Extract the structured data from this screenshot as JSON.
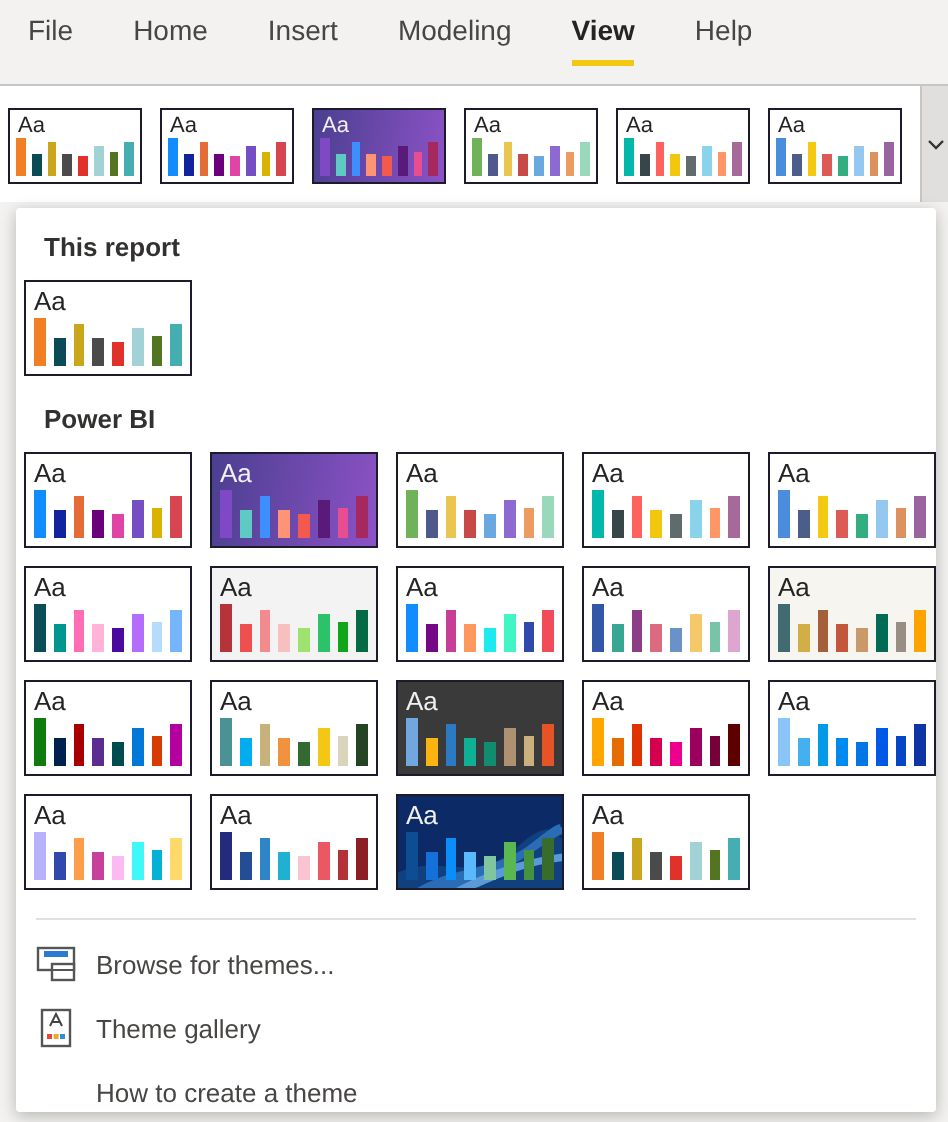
{
  "tabs": [
    {
      "label": "File",
      "selected": false
    },
    {
      "label": "Home",
      "selected": false
    },
    {
      "label": "Insert",
      "selected": false
    },
    {
      "label": "Modeling",
      "selected": false
    },
    {
      "label": "View",
      "selected": true
    },
    {
      "label": "Help",
      "selected": false
    }
  ],
  "ribbon": {
    "themes": [
      {
        "label": "Aa",
        "kind": "light",
        "bars": [
          {
            "color": "#f07f26"
          },
          {
            "color": "#0b4a57"
          },
          {
            "color": "#c9a61a"
          },
          {
            "color": "#4b4b4b"
          },
          {
            "color": "#e0312a"
          },
          {
            "color": "#a2d2d6"
          },
          {
            "color": "#537420"
          },
          {
            "color": "#45aeb1"
          }
        ]
      },
      {
        "label": "Aa",
        "kind": "light",
        "bars": [
          {
            "color": "#118dff"
          },
          {
            "color": "#12239e"
          },
          {
            "color": "#e66c37"
          },
          {
            "color": "#6b007b"
          },
          {
            "color": "#e044a7"
          },
          {
            "color": "#744ec2"
          },
          {
            "color": "#d9b300"
          },
          {
            "color": "#d64550"
          }
        ]
      },
      {
        "label": "Aa",
        "kind": "gradient",
        "bars": [
          {
            "color": "#7f48c4"
          },
          {
            "color": "#5ecac3"
          },
          {
            "color": "#3d8eff"
          },
          {
            "color": "#ff9375"
          },
          {
            "color": "#f25a50"
          },
          {
            "color": "#5a1a7a"
          },
          {
            "color": "#e84c91"
          },
          {
            "color": "#a5285e"
          }
        ]
      },
      {
        "label": "Aa",
        "kind": "light",
        "bars": [
          {
            "color": "#6fb25a"
          },
          {
            "color": "#4f5a8c"
          },
          {
            "color": "#eac54f"
          },
          {
            "color": "#c84a47"
          },
          {
            "color": "#6aa9e0"
          },
          {
            "color": "#8c6ad2"
          },
          {
            "color": "#ee9b62"
          },
          {
            "color": "#98d9bc"
          }
        ]
      },
      {
        "label": "Aa",
        "kind": "light",
        "bars": [
          {
            "color": "#01b8aa"
          },
          {
            "color": "#374649"
          },
          {
            "color": "#fd625e"
          },
          {
            "color": "#f2c80f"
          },
          {
            "color": "#5f6b6d"
          },
          {
            "color": "#8ad4eb"
          },
          {
            "color": "#fe9666"
          },
          {
            "color": "#a66999"
          }
        ]
      },
      {
        "label": "Aa",
        "kind": "light",
        "bars": [
          {
            "color": "#4a8ddc"
          },
          {
            "color": "#4c5d8a"
          },
          {
            "color": "#f3c911"
          },
          {
            "color": "#dc5b57"
          },
          {
            "color": "#33ae81"
          },
          {
            "color": "#95c8f0"
          },
          {
            "color": "#dd915f"
          },
          {
            "color": "#9a64a0"
          }
        ]
      }
    ]
  },
  "menu": {
    "sections": [
      {
        "title": "This report",
        "themes": [
          {
            "label": "Aa",
            "kind": "light",
            "bars": [
              {
                "color": "#f07f26"
              },
              {
                "color": "#0b4a57"
              },
              {
                "color": "#c9a61a"
              },
              {
                "color": "#4b4b4b"
              },
              {
                "color": "#e0312a"
              },
              {
                "color": "#a2d2d6"
              },
              {
                "color": "#537420"
              },
              {
                "color": "#45aeb1"
              }
            ]
          }
        ]
      },
      {
        "title": "Power BI",
        "themes": [
          {
            "label": "Aa",
            "kind": "light",
            "bars": [
              {
                "color": "#118dff"
              },
              {
                "color": "#12239e"
              },
              {
                "color": "#e66c37"
              },
              {
                "color": "#6b007b"
              },
              {
                "color": "#e044a7"
              },
              {
                "color": "#744ec2"
              },
              {
                "color": "#d9b300"
              },
              {
                "color": "#d64550"
              }
            ]
          },
          {
            "label": "Aa",
            "kind": "gradient",
            "bars": [
              {
                "color": "#7f48c4"
              },
              {
                "color": "#5ecac3"
              },
              {
                "color": "#3d8eff"
              },
              {
                "color": "#ff9375"
              },
              {
                "color": "#f25a50"
              },
              {
                "color": "#5a1a7a"
              },
              {
                "color": "#e84c91"
              },
              {
                "color": "#a5285e"
              }
            ]
          },
          {
            "label": "Aa",
            "kind": "light",
            "bars": [
              {
                "color": "#6fb25a"
              },
              {
                "color": "#4f5a8c"
              },
              {
                "color": "#eac54f"
              },
              {
                "color": "#c84a47"
              },
              {
                "color": "#6aa9e0"
              },
              {
                "color": "#8c6ad2"
              },
              {
                "color": "#ee9b62"
              },
              {
                "color": "#98d9bc"
              }
            ]
          },
          {
            "label": "Aa",
            "kind": "light",
            "bars": [
              {
                "color": "#01b8aa"
              },
              {
                "color": "#374649"
              },
              {
                "color": "#fd625e"
              },
              {
                "color": "#f2c80f"
              },
              {
                "color": "#5f6b6d"
              },
              {
                "color": "#8ad4eb"
              },
              {
                "color": "#fe9666"
              },
              {
                "color": "#a66999"
              }
            ]
          },
          {
            "label": "Aa",
            "kind": "light",
            "bars": [
              {
                "color": "#4a8ddc"
              },
              {
                "color": "#4c5d8a"
              },
              {
                "color": "#f3c911"
              },
              {
                "color": "#dc5b57"
              },
              {
                "color": "#33ae81"
              },
              {
                "color": "#95c8f0"
              },
              {
                "color": "#dd915f"
              },
              {
                "color": "#9a64a0"
              }
            ]
          },
          {
            "label": "Aa",
            "kind": "light",
            "bars": [
              {
                "color": "#0b4e57"
              },
              {
                "color": "#009690"
              },
              {
                "color": "#ff6eb5"
              },
              {
                "color": "#ffb3d9"
              },
              {
                "color": "#4a0a9e"
              },
              {
                "color": "#b56cfa"
              },
              {
                "color": "#b5dcfc"
              },
              {
                "color": "#74b5fc"
              }
            ]
          },
          {
            "label": "Aa",
            "kind": "grey",
            "bars": [
              {
                "color": "#b5343a"
              },
              {
                "color": "#ee5050"
              },
              {
                "color": "#f28a8e"
              },
              {
                "color": "#f8bfbf"
              },
              {
                "color": "#9ee36f"
              },
              {
                "color": "#2bc26a"
              },
              {
                "color": "#11a51a"
              },
              {
                "color": "#046a45"
              }
            ]
          },
          {
            "label": "Aa",
            "kind": "light",
            "bars": [
              {
                "color": "#118dff"
              },
              {
                "color": "#750985"
              },
              {
                "color": "#c83d95"
              },
              {
                "color": "#ff985e"
              },
              {
                "color": "#1de9f0"
              },
              {
                "color": "#41f5c4"
              },
              {
                "color": "#3049ad"
              },
              {
                "color": "#f24b59"
              }
            ]
          },
          {
            "label": "Aa",
            "kind": "light",
            "bars": [
              {
                "color": "#3257a8"
              },
              {
                "color": "#37a794"
              },
              {
                "color": "#8b3d88"
              },
              {
                "color": "#dd6b7f"
              },
              {
                "color": "#6b91c9"
              },
              {
                "color": "#f5c869"
              },
              {
                "color": "#77c4a8"
              },
              {
                "color": "#dea6cf"
              }
            ]
          },
          {
            "label": "Aa",
            "kind": "cream",
            "bars": [
              {
                "color": "#426a71"
              },
              {
                "color": "#d3ad46"
              },
              {
                "color": "#a66039"
              },
              {
                "color": "#c3573b"
              },
              {
                "color": "#c9996a"
              },
              {
                "color": "#026b55"
              },
              {
                "color": "#9a8e84"
              },
              {
                "color": "#ffa300"
              }
            ]
          },
          {
            "label": "Aa",
            "kind": "light",
            "bars": [
              {
                "color": "#107c10"
              },
              {
                "color": "#002050"
              },
              {
                "color": "#a80000"
              },
              {
                "color": "#5c2d91"
              },
              {
                "color": "#004b50"
              },
              {
                "color": "#0078d7"
              },
              {
                "color": "#d83b01"
              },
              {
                "color": "#b4009e"
              }
            ]
          },
          {
            "label": "Aa",
            "kind": "light",
            "bars": [
              {
                "color": "#4a9294"
              },
              {
                "color": "#00aef0"
              },
              {
                "color": "#c6b27a"
              },
              {
                "color": "#f29240"
              },
              {
                "color": "#336a32"
              },
              {
                "color": "#f2c814"
              },
              {
                "color": "#d8d5bc"
              },
              {
                "color": "#254423"
              }
            ]
          },
          {
            "label": "Aa",
            "kind": "dark",
            "bars": [
              {
                "color": "#70a7de"
              },
              {
                "color": "#fbb30f"
              },
              {
                "color": "#2c7ac2"
              },
              {
                "color": "#10b094"
              },
              {
                "color": "#118c6f"
              },
              {
                "color": "#ae9170"
              },
              {
                "color": "#c9b07d"
              },
              {
                "color": "#e55327"
              }
            ]
          },
          {
            "label": "Aa",
            "kind": "light",
            "bars": [
              {
                "color": "#ffa600"
              },
              {
                "color": "#e56c00"
              },
              {
                "color": "#e03200"
              },
              {
                "color": "#d4004f"
              },
              {
                "color": "#ec008d"
              },
              {
                "color": "#9b005f"
              },
              {
                "color": "#780038"
              },
              {
                "color": "#5c0000"
              }
            ]
          },
          {
            "label": "Aa",
            "kind": "light",
            "bars": [
              {
                "color": "#8bc5f8"
              },
              {
                "color": "#45b0ef"
              },
              {
                "color": "#039ae8"
              },
              {
                "color": "#0089ee"
              },
              {
                "color": "#0177e6"
              },
              {
                "color": "#0059e6"
              },
              {
                "color": "#0546c6"
              },
              {
                "color": "#0f34a5"
              }
            ]
          },
          {
            "label": "Aa",
            "kind": "light",
            "bars": [
              {
                "color": "#b8b1fb"
              },
              {
                "color": "#3148ae"
              },
              {
                "color": "#ff9e4a"
              },
              {
                "color": "#c7409c"
              },
              {
                "color": "#fdb9f1"
              },
              {
                "color": "#41f8f8"
              },
              {
                "color": "#04b1d7"
              },
              {
                "color": "#ffd96a"
              }
            ]
          },
          {
            "label": "Aa",
            "kind": "light",
            "bars": [
              {
                "color": "#252b7c"
              },
              {
                "color": "#234e95"
              },
              {
                "color": "#2e86c8"
              },
              {
                "color": "#20b0d2"
              },
              {
                "color": "#fbc4d3"
              },
              {
                "color": "#eb5864"
              },
              {
                "color": "#b23238"
              },
              {
                "color": "#8e1e25"
              }
            ]
          },
          {
            "label": "Aa",
            "kind": "picture",
            "bars": [
              {
                "color": "#0d4d94"
              },
              {
                "color": "#1570d9"
              },
              {
                "color": "#0c8ef8"
              },
              {
                "color": "#5ab9fa"
              },
              {
                "color": "#7ec5a0"
              },
              {
                "color": "#5bb750"
              },
              {
                "color": "#459240"
              },
              {
                "color": "#376c2c"
              }
            ]
          },
          {
            "label": "Aa",
            "kind": "light",
            "bars": [
              {
                "color": "#f07f26"
              },
              {
                "color": "#0b4a57"
              },
              {
                "color": "#c9a61a"
              },
              {
                "color": "#4b4b4b"
              },
              {
                "color": "#e0312a"
              },
              {
                "color": "#a2d2d6"
              },
              {
                "color": "#537420"
              },
              {
                "color": "#45aeb1"
              }
            ]
          }
        ]
      }
    ],
    "actions": [
      {
        "kind": "browse",
        "label": "Browse for themes..."
      },
      {
        "kind": "gallery",
        "label": "Theme gallery"
      },
      {
        "kind": "help",
        "label": "How to create a theme"
      }
    ]
  }
}
